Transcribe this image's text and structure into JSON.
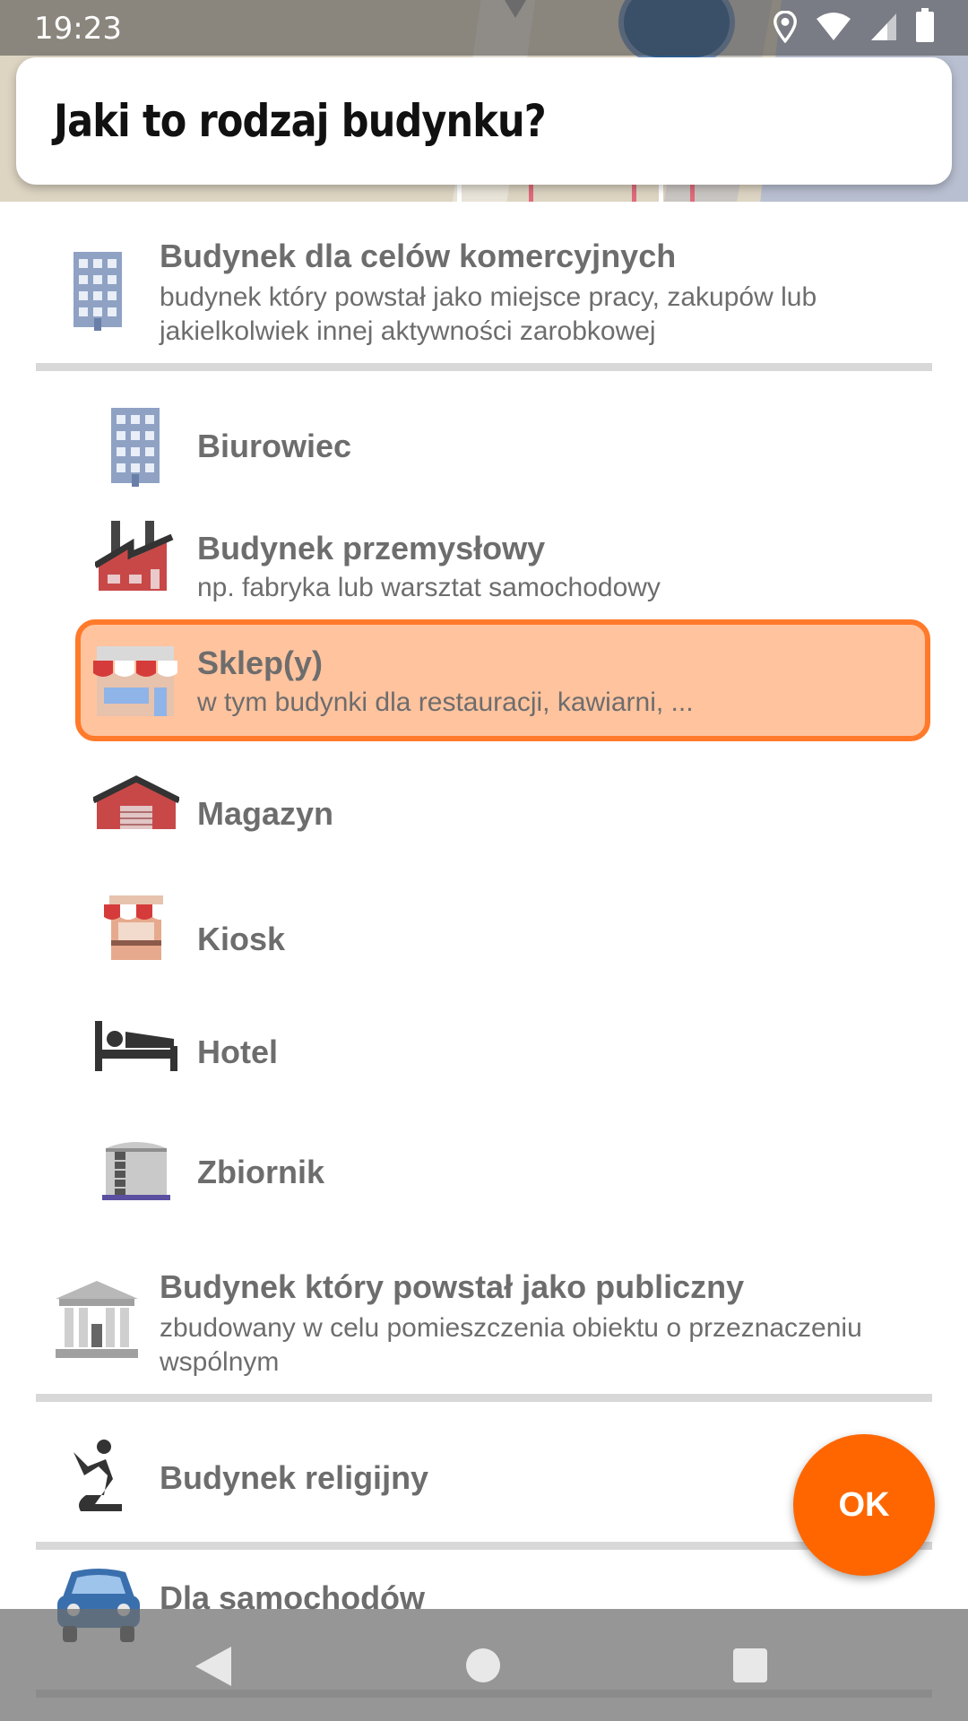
{
  "status_bar": {
    "time": "19:23"
  },
  "header": {
    "title": "Jaki to rodzaj budynku?"
  },
  "categories": [
    {
      "title": "Budynek dla celów komercyjnych",
      "description": "budynek który powstał jako miejsce pracy, zakupów lub jakielkolwiek innej aktywności zarobkowej",
      "icon": "office-building-icon"
    },
    {
      "title": "Budynek który powstał jako publiczny",
      "description": "zbudowany w celu pomieszczenia obiektu o przeznaczeniu wspólnym",
      "icon": "public-building-icon"
    },
    {
      "title": "Budynek religijny",
      "icon": "praying-person-icon"
    },
    {
      "title": "Dla samochodów",
      "icon": "car-icon"
    }
  ],
  "subitems": [
    {
      "title": "Biurowiec",
      "icon": "office-building-icon"
    },
    {
      "title": "Budynek przemysłowy",
      "description": "np. fabryka lub warsztat samochodowy",
      "icon": "factory-icon"
    },
    {
      "title": "Sklep(y)",
      "description": "w tym budynki dla restauracji, kawiarni, ...",
      "icon": "shop-icon",
      "selected": true
    },
    {
      "title": "Magazyn",
      "icon": "warehouse-icon"
    },
    {
      "title": "Kiosk",
      "icon": "kiosk-icon"
    },
    {
      "title": "Hotel",
      "icon": "bed-icon"
    },
    {
      "title": "Zbiornik",
      "icon": "storage-tank-icon"
    }
  ],
  "ok_button": {
    "label": "OK"
  },
  "colors": {
    "accent": "#ff6600",
    "selected_fill": "#ffc39e",
    "selected_border": "#ff7a2a",
    "text": "#6d6d6d"
  }
}
